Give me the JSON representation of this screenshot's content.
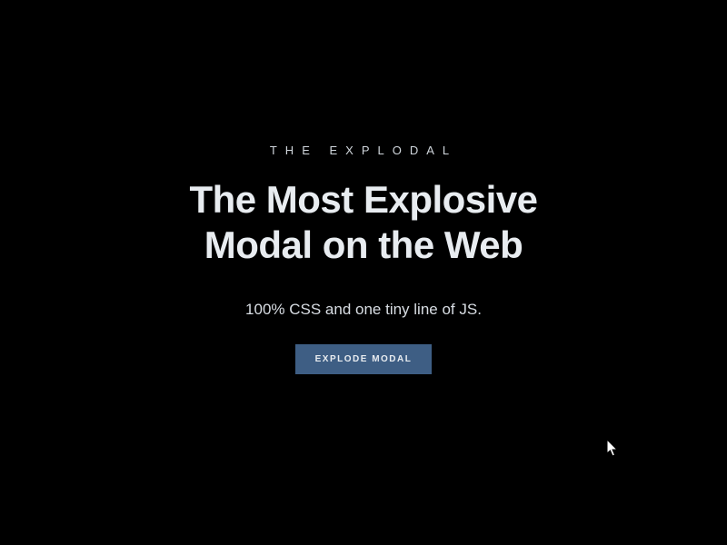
{
  "hero": {
    "eyebrow": "THE EXPLODAL",
    "headline_line1": "The Most Explosive",
    "headline_line2": "Modal on the Web",
    "subhead": "100% CSS and one tiny line of JS.",
    "cta_label": "EXPLODE MODAL"
  }
}
